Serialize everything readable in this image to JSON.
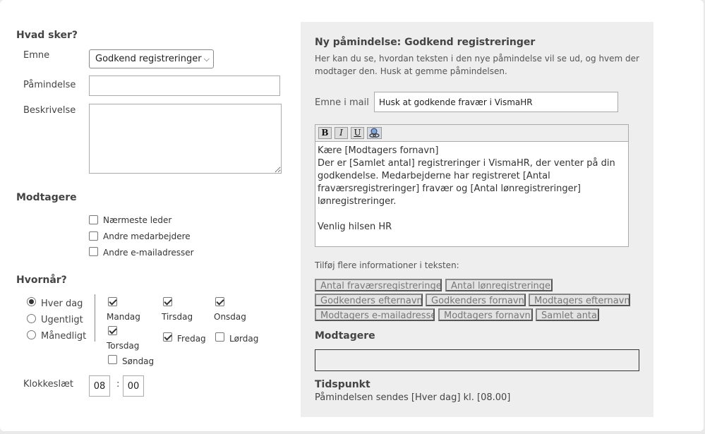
{
  "form": {
    "section_what": "Hvad sker?",
    "subject_label": "Emne",
    "subject_value": "Godkend registreringer",
    "reminder_label": "Påmindelse",
    "reminder_value": "",
    "description_label": "Beskrivelse",
    "description_value": "",
    "section_recipients": "Modtagere",
    "recipients": [
      {
        "label": "Nærmeste leder",
        "checked": false
      },
      {
        "label": "Andre medarbejdere",
        "checked": false
      },
      {
        "label": "Andre e-mailadresser",
        "checked": false
      }
    ],
    "section_when": "Hvornår?",
    "frequency": [
      {
        "label": "Hver dag",
        "checked": true
      },
      {
        "label": "Ugentligt",
        "checked": false
      },
      {
        "label": "Månedligt",
        "checked": false
      }
    ],
    "days": [
      {
        "label": "Mandag",
        "checked": true
      },
      {
        "label": "Tirsdag",
        "checked": true
      },
      {
        "label": "Onsdag",
        "checked": true
      },
      {
        "label": "Torsdag",
        "checked": true
      },
      {
        "label": "Fredag",
        "checked": true
      },
      {
        "label": "Lørdag",
        "checked": false
      },
      {
        "label": "Søndag",
        "checked": false
      }
    ],
    "time_label": "Klokkeslæt",
    "time_hour": "08",
    "time_separator": ":",
    "time_minute": "00"
  },
  "preview": {
    "title": "Ny påmindelse: Godkend registreringer",
    "intro_line1": "Her kan du se, hvordan teksten i den nye påmindelse vil se ud, og hvem der",
    "intro_line2": "modtager den. Husk at gemme påmindelsen.",
    "mail_subject_label": "Emne i mail",
    "mail_subject_value": "Husk at godkende fravær i VismaHR",
    "toolbar": {
      "bold": "B",
      "italic": "I",
      "underline": "U"
    },
    "body_lines": [
      "Kære [Modtagers fornavn]",
      "Der er [Samlet antal] registreringer i VismaHR, der venter på din",
      "godkendelse. Medarbejderne har registreret [Antal",
      "fraværsregistreringer] fravær og [Antal lønregistreringer]",
      "lønregistreringer.",
      "",
      "Venlig hilsen HR"
    ],
    "add_info_label": "Tilføj flere informationer i teksten:",
    "placeholders": [
      "Antal fraværsregistreringer",
      "Antal lønregistreringer",
      "Godkenders efternavn",
      "Godkenders fornavn",
      "Modtagers efternavn",
      "Modtagers e-mailadresse",
      "Modtagers fornavn",
      "Samlet antal"
    ],
    "recipients_title": "Modtagere",
    "recipients_value": "",
    "schedule_title": "Tidspunkt",
    "schedule_text": "Påmindelsen sendes [Hver dag] kl. [08.00]"
  }
}
